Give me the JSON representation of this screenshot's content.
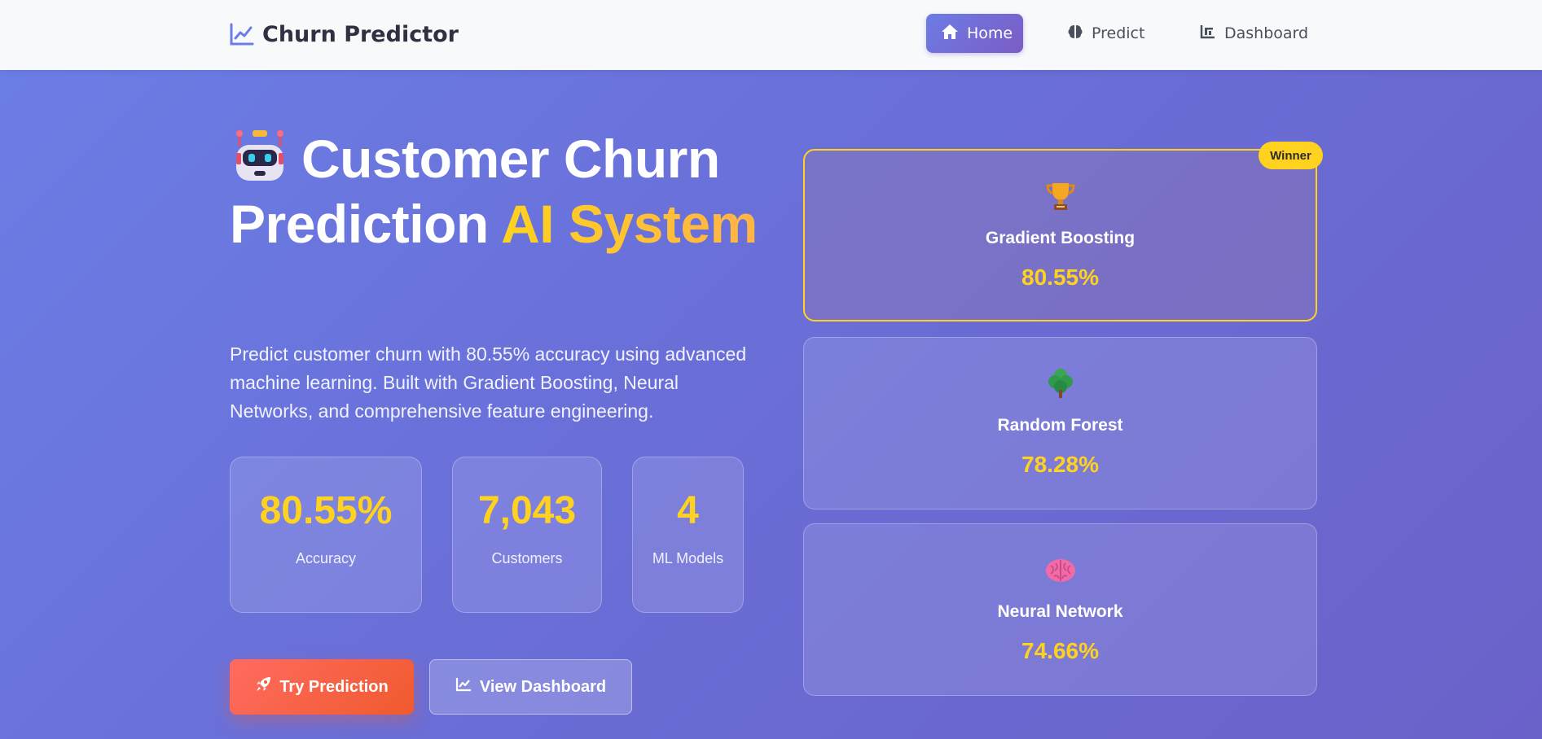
{
  "brand": {
    "name": "Churn Predictor",
    "icon": "chart-line-icon"
  },
  "nav": {
    "items": [
      {
        "label": "Home",
        "icon": "home-icon",
        "active": true
      },
      {
        "label": "Predict",
        "icon": "brain-icon",
        "active": false
      },
      {
        "label": "Dashboard",
        "icon": "bar-chart-icon",
        "active": false
      }
    ]
  },
  "hero": {
    "emoji": "robot-icon",
    "title_main": "Customer Churn Prediction ",
    "title_accent": "AI System",
    "description": "Predict customer churn with 80.55% accuracy using advanced machine learning. Built with Gradient Boosting, Neural Networks, and comprehensive feature engineering."
  },
  "stats": [
    {
      "value": "80.55%",
      "label": "Accuracy"
    },
    {
      "value": "7,043",
      "label": "Customers"
    },
    {
      "value": "4",
      "label": "ML Models"
    }
  ],
  "buttons": {
    "primary": {
      "label": "Try Prediction",
      "icon": "rocket-icon"
    },
    "secondary": {
      "label": "View Dashboard",
      "icon": "chart-line-icon"
    }
  },
  "models": [
    {
      "name": "Gradient Boosting",
      "score": "80.55%",
      "icon": "trophy-icon",
      "winner": true
    },
    {
      "name": "Random Forest",
      "score": "78.28%",
      "icon": "tree-icon",
      "winner": false
    },
    {
      "name": "Neural Network",
      "score": "74.66%",
      "icon": "brain-icon",
      "winner": false
    }
  ],
  "badge": {
    "label": "Winner"
  },
  "colors": {
    "accent": "#ffd21f",
    "primary_gradient_start": "#6d7ce6",
    "primary_gradient_end": "#7b5cc4",
    "cta": "#f05a2e",
    "background": "#6a6fd8"
  }
}
